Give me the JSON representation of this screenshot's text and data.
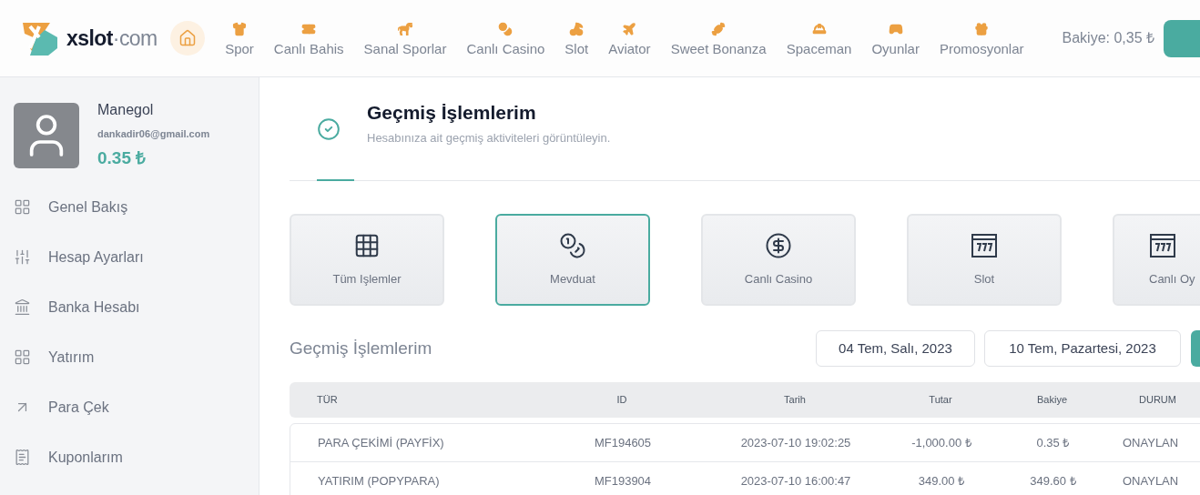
{
  "header": {
    "logo": {
      "name": "xslot",
      "suffix": "·com"
    },
    "nav": [
      {
        "selected": true
      },
      {
        "label": "Spor",
        "selected": false
      },
      {
        "label": "Canlı Bahis",
        "selected": false
      },
      {
        "label": "Sanal Sporlar",
        "selected": false
      },
      {
        "label": "Canlı Casino",
        "selected": false
      },
      {
        "label": "Slot",
        "selected": false
      },
      {
        "label": "Aviator",
        "selected": false
      },
      {
        "label": "Sweet Bonanza",
        "selected": false
      },
      {
        "label": "Spaceman",
        "selected": false
      },
      {
        "label": "Oyunlar",
        "selected": false
      },
      {
        "label": "Promosyonlar",
        "selected": false
      }
    ],
    "balance": "Bakiye: 0,35 ₺"
  },
  "profile": {
    "name": "Manegol",
    "email": "dankadir06@gmail.com",
    "balance": "0.35 ₺"
  },
  "sidebar": {
    "items": [
      {
        "label": "Genel Bakış"
      },
      {
        "label": "Hesap Ayarları"
      },
      {
        "label": "Banka Hesabı"
      },
      {
        "label": "Yatırım"
      },
      {
        "label": "Para Çek"
      },
      {
        "label": "Kuponlarım"
      }
    ]
  },
  "page_header": {
    "title": "Geçmiş İşlemlerim",
    "subtitle": "Hesabınıza ait geçmiş aktiviteleri görüntüleyin."
  },
  "categories": [
    {
      "label": "Tüm Işlemler",
      "selected": false
    },
    {
      "label": "Mevduat",
      "selected": true
    },
    {
      "label": "Canlı Casino",
      "selected": false
    },
    {
      "label": "Slot",
      "selected": false
    },
    {
      "label": "Canlı Oy",
      "selected": false
    }
  ],
  "history": {
    "title": "Geçmiş İşlemlerim",
    "date_from": "04 Tem, Salı, 2023",
    "date_to": "10 Tem, Pazartesi, 2023",
    "table": {
      "columns": [
        "TÜR",
        "ID",
        "Tarih",
        "Tutar",
        "Bakiye",
        "DURUM"
      ],
      "rows": [
        [
          "PARA ÇEKİMİ (PAYFİX)",
          "MF194605",
          "2023-07-10 19:02:25",
          "-1,000.00 ₺",
          "0.35 ₺",
          "ONAYLAN"
        ],
        [
          "YATIRIM (POPYPARA)",
          "MF193904",
          "2023-07-10 16:00:47",
          "349.00 ₺",
          "349.60 ₺",
          "ONAYLAN"
        ]
      ]
    }
  }
}
